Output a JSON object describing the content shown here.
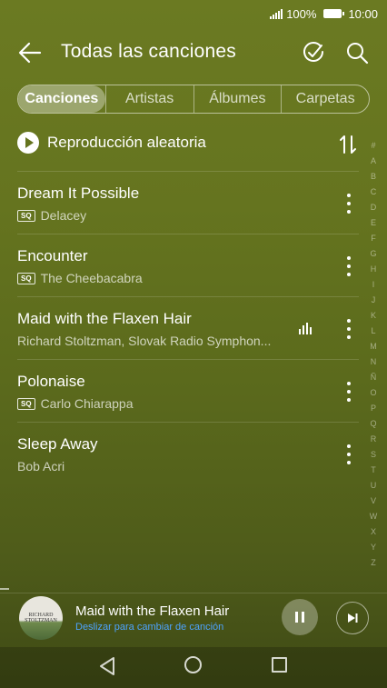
{
  "status_bar": {
    "battery": "100%",
    "time": "10:00"
  },
  "header": {
    "title": "Todas las canciones"
  },
  "tabs": [
    {
      "label": "Canciones",
      "active": true
    },
    {
      "label": "Artistas",
      "active": false
    },
    {
      "label": "Álbumes",
      "active": false
    },
    {
      "label": "Carpetas",
      "active": false
    }
  ],
  "shuffle": {
    "label": "Reproducción aleatoria"
  },
  "songs": [
    {
      "title": "Dream It Possible",
      "artist": "Delacey",
      "sq": true,
      "playing": false
    },
    {
      "title": "Encounter",
      "artist": "The Cheebacabra",
      "sq": true,
      "playing": false
    },
    {
      "title": "Maid with the Flaxen Hair",
      "artist": "Richard Stoltzman, Slovak Radio Symphon...",
      "sq": false,
      "playing": true
    },
    {
      "title": "Polonaise",
      "artist": "Carlo Chiarappa",
      "sq": true,
      "playing": false
    },
    {
      "title": "Sleep Away",
      "artist": "Bob Acri",
      "sq": false,
      "playing": false
    }
  ],
  "sq_badge": "SQ",
  "alpha_index": [
    "#",
    "A",
    "B",
    "C",
    "D",
    "E",
    "F",
    "G",
    "H",
    "I",
    "J",
    "K",
    "L",
    "M",
    "N",
    "Ñ",
    "O",
    "P",
    "Q",
    "R",
    "S",
    "T",
    "U",
    "V",
    "W",
    "X",
    "Y",
    "Z"
  ],
  "now_playing": {
    "title": "Maid with the Flaxen Hair",
    "hint": "Deslizar para cambiar de canción",
    "album_art_text": "RICHARD STOLTZMAN"
  },
  "colors": {
    "background": "#65741f",
    "hint_blue": "#4da3ff"
  },
  "icons": {
    "back": "arrow-left-icon",
    "edit": "circle-check-icon",
    "search": "search-icon",
    "sort": "sort-arrows-icon",
    "more": "more-vertical-icon",
    "equalizer": "equalizer-icon",
    "pause": "pause-icon",
    "next": "skip-next-icon"
  }
}
